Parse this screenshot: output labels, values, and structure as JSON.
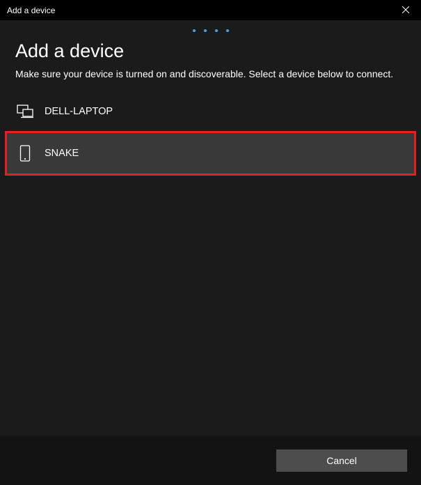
{
  "titlebar": {
    "title": "Add a device"
  },
  "main": {
    "heading": "Add a device",
    "subtext": "Make sure your device is turned on and discoverable. Select a device below to connect."
  },
  "devices": [
    {
      "icon": "pc-icon",
      "label": "DELL-LAPTOP",
      "highlighted": false
    },
    {
      "icon": "phone-icon",
      "label": "SNAKE",
      "highlighted": true
    }
  ],
  "footer": {
    "cancel_label": "Cancel"
  }
}
